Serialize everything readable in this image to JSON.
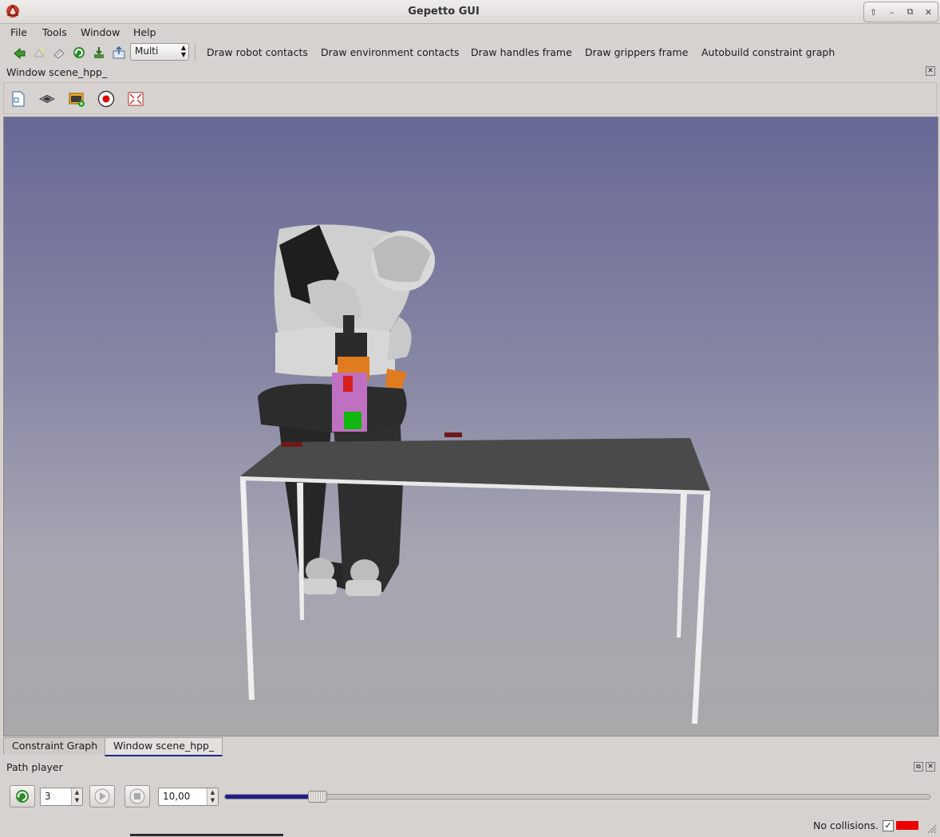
{
  "window": {
    "title": "Gepetto GUI",
    "wm_buttons": [
      "⇧",
      "–",
      "⧉",
      "✕"
    ]
  },
  "menu": {
    "file": "File",
    "tools": "Tools",
    "window": "Window",
    "help": "Help"
  },
  "toolbar": {
    "icons": [
      "add-robot-icon",
      "reload-icon-disabled",
      "erase-icon",
      "refresh-icon",
      "download-icon",
      "export-icon"
    ],
    "mode_select": "Multi",
    "actions": {
      "draw_robot_contacts": "Draw robot contacts",
      "draw_environment_contacts": "Draw environment contacts",
      "draw_handles_frame": "Draw handles frame",
      "draw_grippers_frame": "Draw grippers frame",
      "autobuild_constraint_graph": "Autobuild constraint graph"
    }
  },
  "scene_dock": {
    "title": "Window scene_hpp_",
    "tools": [
      "new-page-icon",
      "grid-icon",
      "screenshot-icon",
      "record-icon",
      "fit-view-icon"
    ]
  },
  "viewport": {
    "background_top": "#686897",
    "background_bottom": "#a9a9ab"
  },
  "tabs": {
    "constraint_graph": "Constraint Graph",
    "window_scene": "Window scene_hpp_"
  },
  "path_player": {
    "title": "Path player",
    "path_index": "3",
    "time_scale": "10,00",
    "progress": 0.13
  },
  "status": {
    "collision_text": "No collisions.",
    "collision_checked": "✓",
    "collision_color": "#ee0000"
  }
}
